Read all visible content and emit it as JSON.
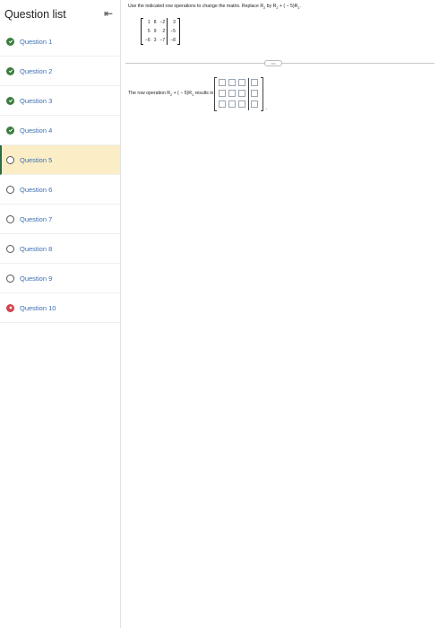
{
  "sidebar": {
    "title": "Question list",
    "collapse_icon": "⇤",
    "items": [
      {
        "label": "Question 1",
        "status": "complete"
      },
      {
        "label": "Question 2",
        "status": "complete"
      },
      {
        "label": "Question 3",
        "status": "complete"
      },
      {
        "label": "Question 4",
        "status": "complete"
      },
      {
        "label": "Question 5",
        "status": "current"
      },
      {
        "label": "Question 6",
        "status": "unanswered"
      },
      {
        "label": "Question 7",
        "status": "unanswered"
      },
      {
        "label": "Question 8",
        "status": "unanswered"
      },
      {
        "label": "Question 9",
        "status": "unanswered"
      },
      {
        "label": "Question 10",
        "status": "incorrect"
      }
    ]
  },
  "problem": {
    "instruction_pre": "Use the indicated row operations to change the matrix. Replace R",
    "instruction_sub1": "2",
    "instruction_mid": " by R",
    "instruction_sub2": "2",
    "instruction_mid2": " + ( − 5)R",
    "instruction_sub3": "1",
    "instruction_post": ".",
    "matrix": [
      [
        "1",
        "8",
        "−2",
        "3"
      ],
      [
        "5",
        "9",
        "2",
        "−5"
      ],
      [
        "−6",
        "3",
        "−7",
        "−8"
      ]
    ],
    "result_pre": "The row operation R",
    "result_sub1": "2",
    "result_mid": " + ( − 5)R",
    "result_sub2": "1",
    "result_post": " results in",
    "answer_rows": 3,
    "answer_cols": 4,
    "period": "."
  },
  "colors": {
    "active_bg": "#fbeec6",
    "complete": "#3a7d3e",
    "incorrect": "#d0434a",
    "link": "#3b6fb6"
  }
}
